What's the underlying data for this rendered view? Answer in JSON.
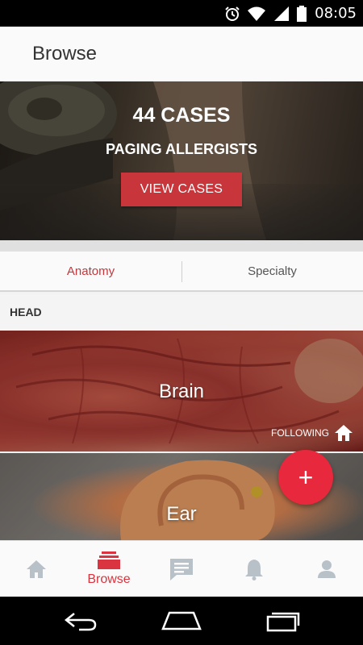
{
  "status_bar": {
    "time": "08:05",
    "icons": [
      "alarm-icon",
      "wifi-icon",
      "signal-icon",
      "battery-icon"
    ]
  },
  "app_bar": {
    "title": "Browse"
  },
  "hero": {
    "count_text": "44 CASES",
    "subtitle": "PAGING ALLERGISTS",
    "button_label": "VIEW CASES"
  },
  "tabs": [
    {
      "label": "Anatomy",
      "active": true
    },
    {
      "label": "Specialty",
      "active": false
    }
  ],
  "section": {
    "label": "HEAD"
  },
  "categories": [
    {
      "label": "Brain",
      "following_label": "FOLLOWING",
      "following_icon": "home-icon"
    },
    {
      "label": "Ear"
    }
  ],
  "fab": {
    "icon": "plus-icon",
    "symbol": "+"
  },
  "bottom_nav": {
    "items": [
      {
        "icon": "home-icon",
        "label": ""
      },
      {
        "icon": "browse-icon",
        "label": "Browse",
        "active": true
      },
      {
        "icon": "chat-icon",
        "label": ""
      },
      {
        "icon": "bell-icon",
        "label": ""
      },
      {
        "icon": "profile-icon",
        "label": ""
      }
    ]
  },
  "colors": {
    "accent": "#c8353a",
    "fab": "#e8283c",
    "inactive_icon": "#b8c0c8"
  }
}
